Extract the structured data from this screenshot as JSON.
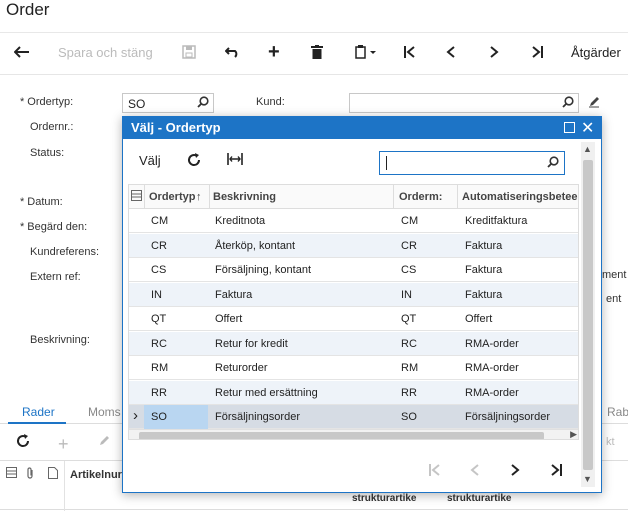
{
  "page": {
    "title": "Order"
  },
  "toolbar": {
    "save_close_label": "Spara och stäng",
    "actions_label": "Åtgärder"
  },
  "form": {
    "ordertyp_label": "Ordertyp:",
    "ordertyp_value": "SO",
    "ordernr_label": "Ordernr.:",
    "status_label": "Status:",
    "datum_label": "Datum:",
    "begard_label": "Begärd den:",
    "kundref_label": "Kundreferens:",
    "externref_label": "Extern ref:",
    "beskrivning_label": "Beskrivning:",
    "kund_label": "Kund:",
    "kund_value": "",
    "partial_ment_1": "ment",
    "partial_ment_2": "ent"
  },
  "tabs": [
    {
      "label": "Rader",
      "active": true
    },
    {
      "label": "Moms",
      "active": false
    },
    {
      "label": "Rab",
      "active": false
    }
  ],
  "grid": {
    "artikelnr_header": "Artikelnur",
    "strukturartikel_1": "strukturartike",
    "strukturartikel_2": "strukturartike",
    "partial_right": "kt"
  },
  "dialog": {
    "title": "Välj - Ordertyp",
    "select_label": "Välj",
    "search_value": "",
    "columns": [
      "Ordertyp",
      "Beskrivning",
      "Orderm:",
      "Automatiseringsbeteende"
    ],
    "rows": [
      {
        "type": "CM",
        "desc": "Kreditnota",
        "ordermall": "CM",
        "auto": "Kreditfaktura"
      },
      {
        "type": "CR",
        "desc": "Återköp, kontant",
        "ordermall": "CR",
        "auto": "Faktura"
      },
      {
        "type": "CS",
        "desc": "Försäljning, kontant",
        "ordermall": "CS",
        "auto": "Faktura"
      },
      {
        "type": "IN",
        "desc": "Faktura",
        "ordermall": "IN",
        "auto": "Faktura"
      },
      {
        "type": "QT",
        "desc": "Offert",
        "ordermall": "QT",
        "auto": "Offert"
      },
      {
        "type": "RC",
        "desc": "Retur for kredit",
        "ordermall": "RC",
        "auto": "RMA-order"
      },
      {
        "type": "RM",
        "desc": "Returorder",
        "ordermall": "RM",
        "auto": "RMA-order"
      },
      {
        "type": "RR",
        "desc": "Retur med ersättning",
        "ordermall": "RR",
        "auto": "RMA-order"
      },
      {
        "type": "SO",
        "desc": "Försäljningsorder",
        "ordermall": "SO",
        "auto": "Försäljningsorder"
      }
    ],
    "selected_index": 8
  },
  "colors": {
    "accent": "#1d74c6",
    "selected_row": "#d6dce4",
    "selected_cell": "#b9d6f1"
  }
}
